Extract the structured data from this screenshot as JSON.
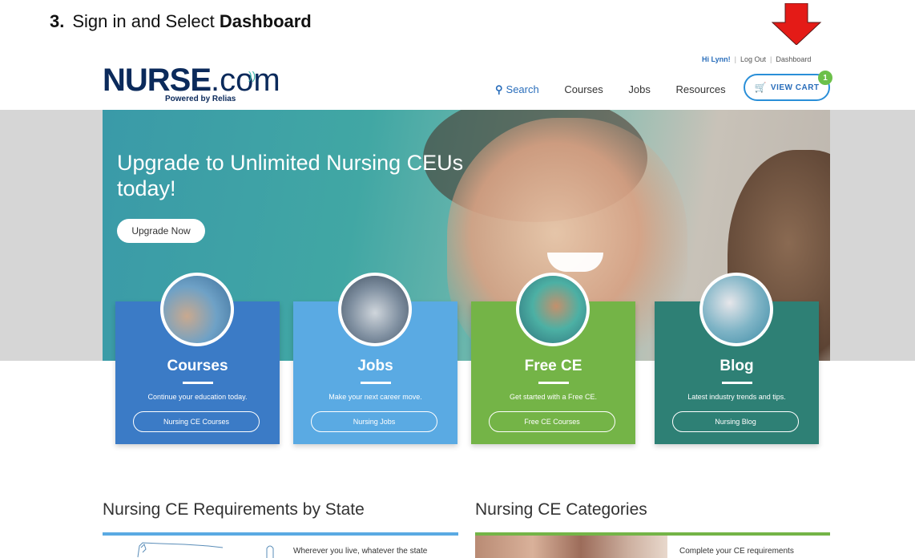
{
  "instruction": {
    "number": "3.",
    "text_before": "Sign in and Select ",
    "text_bold": "Dashboard"
  },
  "site": {
    "logo_main": "NURSE",
    "logo_suffix": ".com",
    "logo_tagline": "Powered by Relias"
  },
  "top_links": {
    "greeting": "Hi Lynn!",
    "logout": "Log Out",
    "dashboard": "Dashboard",
    "separator": "|"
  },
  "nav": {
    "search": "Search",
    "courses": "Courses",
    "jobs": "Jobs",
    "resources": "Resources"
  },
  "cart": {
    "label": "VIEW CART",
    "count": "1"
  },
  "hero": {
    "title": "Upgrade to Unlimited Nursing CEUs today!",
    "button": "Upgrade Now"
  },
  "cards": [
    {
      "title": "Courses",
      "desc": "Continue your education today.",
      "button": "Nursing CE Courses",
      "color": "#3b7bc6"
    },
    {
      "title": "Jobs",
      "desc": "Make your next career move.",
      "button": "Nursing Jobs",
      "color": "#5aaae3"
    },
    {
      "title": "Free CE",
      "desc": "Get started with a Free CE.",
      "button": "Free CE Courses",
      "color": "#74b447"
    },
    {
      "title": "Blog",
      "desc": "Latest industry trends and tips.",
      "button": "Nursing Blog",
      "color": "#2e8075"
    }
  ],
  "sections": {
    "state_title": "Nursing CE Requirements by State",
    "state_text": "Wherever you live, whatever the state",
    "categories_title": "Nursing CE Categories",
    "categories_text": "Complete your CE requirements"
  },
  "colors": {
    "arrow": "#e41b17",
    "state_rule": "#5aaae3",
    "categories_rule": "#74b447"
  }
}
